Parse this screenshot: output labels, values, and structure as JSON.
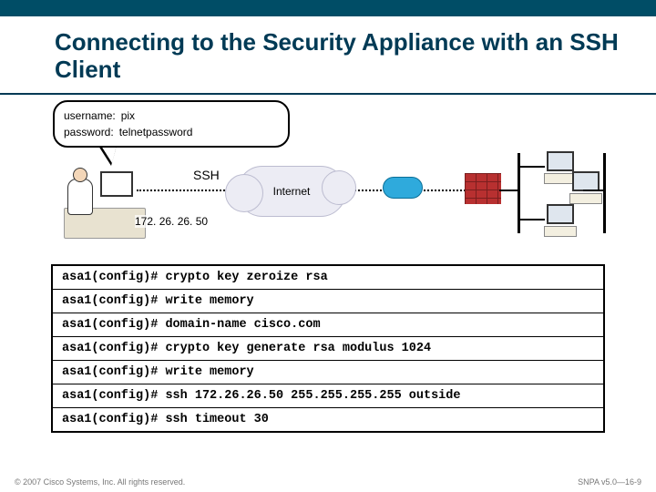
{
  "title": "Connecting to the Security Appliance with an SSH Client",
  "credentials": {
    "username_label": "username:",
    "username_value": "pix",
    "password_label": "password:",
    "password_value": "telnetpassword"
  },
  "diagram": {
    "ssh_label": "SSH",
    "cloud_label": "Internet",
    "client_ip": "172. 26. 26. 50"
  },
  "commands": [
    {
      "prompt": "asa1(config)#",
      "text": "crypto key zeroize rsa"
    },
    {
      "prompt": "asa1(config)#",
      "text": "write memory"
    },
    {
      "prompt": "asa1(config)#",
      "text": "domain-name cisco.com"
    },
    {
      "prompt": "asa1(config)#",
      "text": "crypto key generate rsa modulus 1024"
    },
    {
      "prompt": "asa1(config)#",
      "text": "write memory"
    },
    {
      "prompt": "asa1(config)#",
      "text": "ssh 172.26.26.50 255.255.255.255 outside"
    },
    {
      "prompt": "asa1(config)#",
      "text": "ssh timeout 30"
    }
  ],
  "footer": {
    "copyright": "© 2007 Cisco Systems, Inc. All rights reserved.",
    "code": "SNPA v5.0—16-9"
  }
}
